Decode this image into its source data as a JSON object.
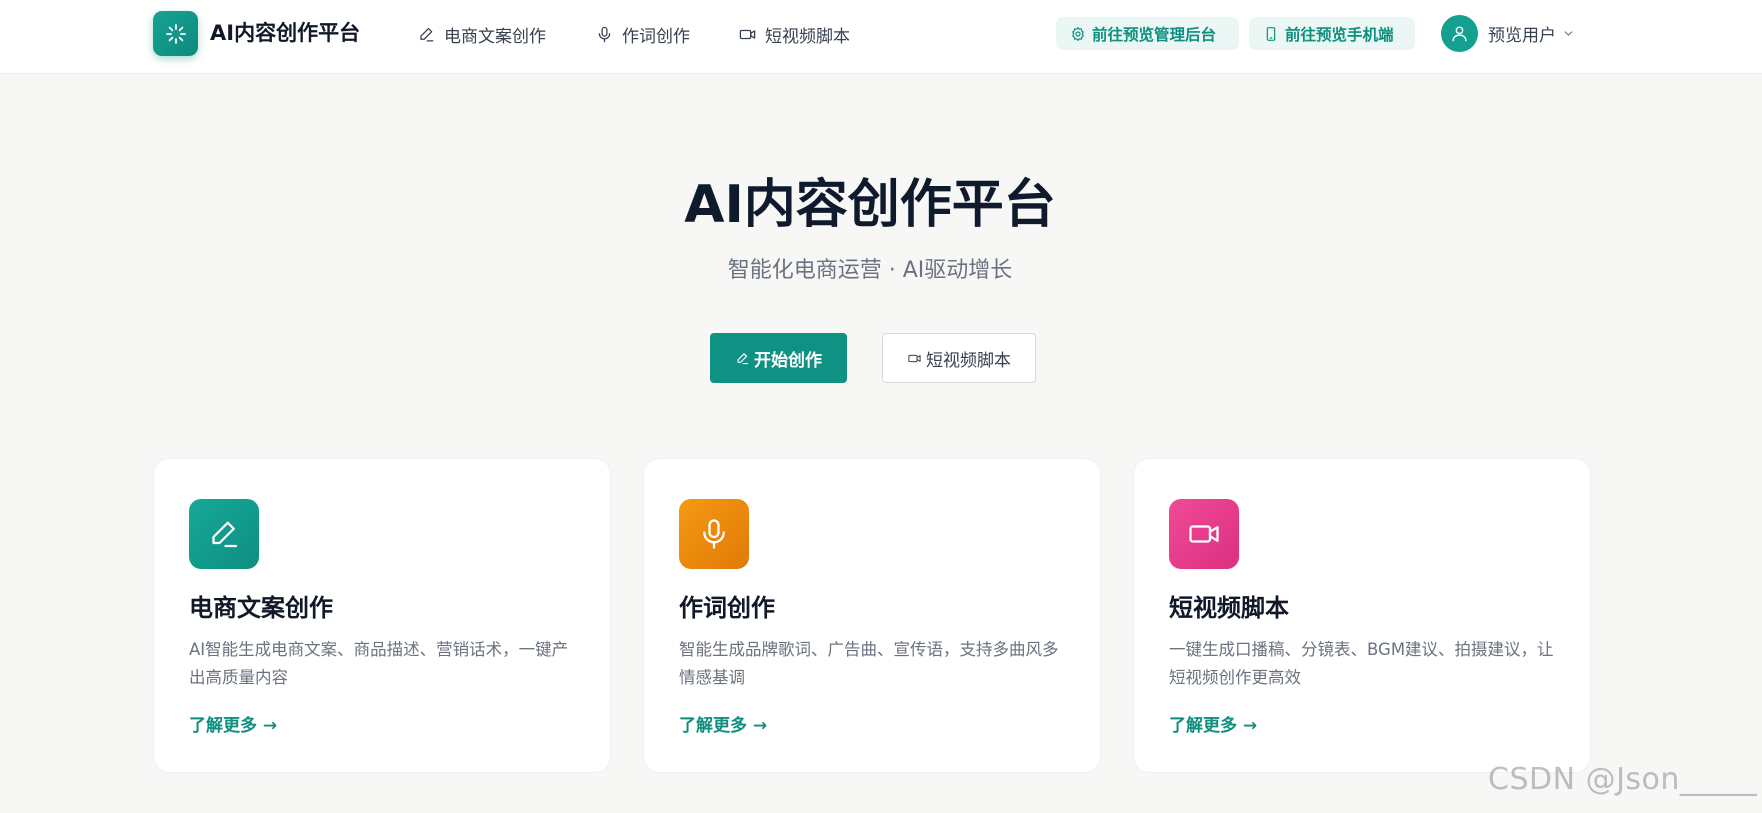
{
  "header": {
    "brand": "AI内容创作平台",
    "nav": [
      {
        "label": "电商文案创作",
        "icon": "pen-icon"
      },
      {
        "label": "作词创作",
        "icon": "microphone-icon"
      },
      {
        "label": "短视频脚本",
        "icon": "video-icon"
      }
    ],
    "admin_link": "前往预览管理后台",
    "mobile_link": "前往预览手机端",
    "user_name": "预览用户"
  },
  "hero": {
    "title": "AI内容创作平台",
    "subtitle": "智能化电商运营 · AI驱动增长",
    "primary_button": "开始创作",
    "secondary_button": "短视频脚本"
  },
  "cards": [
    {
      "title": "电商文案创作",
      "description": "AI智能生成电商文案、商品描述、营销话术，一键产出高质量内容",
      "link": "了解更多 →",
      "icon": "pen-icon",
      "color": "#13a392"
    },
    {
      "title": "作词创作",
      "description": "智能生成品牌歌词、广告曲、宣传语，支持多曲风多情感基调",
      "link": "了解更多 →",
      "icon": "microphone-icon",
      "color": "#f08a0a"
    },
    {
      "title": "短视频脚本",
      "description": "一键生成口播稿、分镜表、BGM建议、拍摄建议，让短视频创作更高效",
      "link": "了解更多 →",
      "icon": "video-icon",
      "color": "#e83d8c"
    }
  ],
  "watermark": "CSDN @Json_____",
  "colors": {
    "accent": "#0f9283",
    "accent_light": "#eaf7f4"
  }
}
